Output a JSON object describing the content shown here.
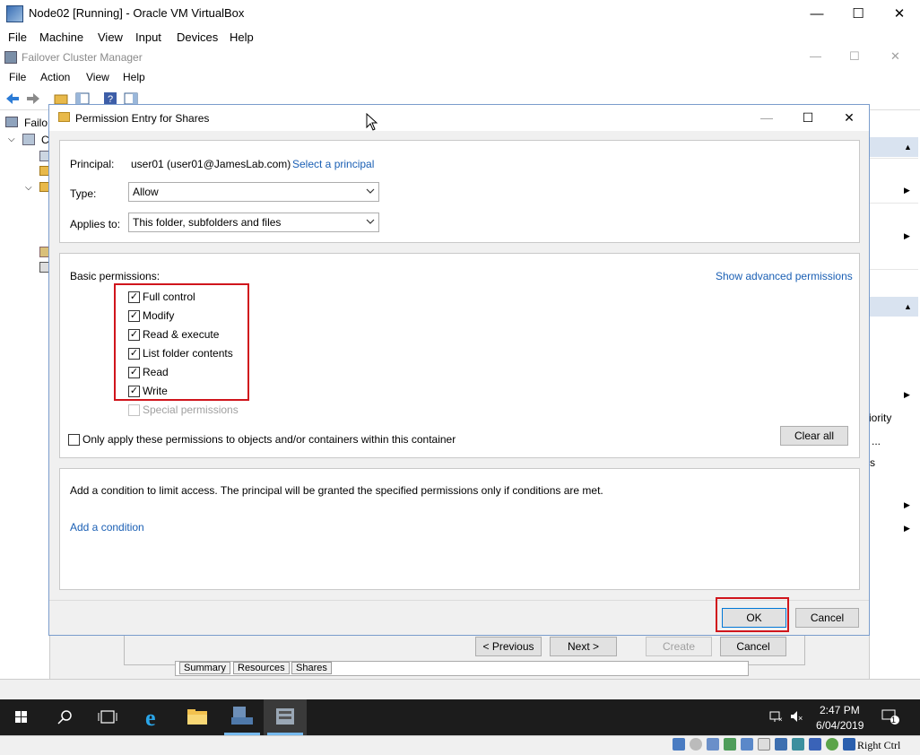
{
  "vbox": {
    "title": "Node02 [Running] - Oracle VM VirtualBox",
    "menu": [
      "File",
      "Machine",
      "View",
      "Input",
      "Devices",
      "Help"
    ],
    "minimize": "—",
    "maximize": "☐",
    "close": "✕",
    "host_key": "Right Ctrl"
  },
  "fcm": {
    "title": "Failover Cluster Manager",
    "menu": [
      "File",
      "Action",
      "View",
      "Help"
    ],
    "tree_root": "Failo",
    "tree_child": "C",
    "right_pane_snippets": [
      "iority",
      "...",
      "s"
    ]
  },
  "wizard": {
    "previous_label": "< Previous",
    "next_label": "Next >",
    "create_label": "Create",
    "cancel_label": "Cancel",
    "tabs": [
      "Summary",
      "Resources",
      "Shares"
    ]
  },
  "dialog": {
    "title": "Permission Entry for Shares",
    "principal_label": "Principal:",
    "principal_value": "user01 (user01@JamesLab.com)",
    "select_principal_link": "Select a principal",
    "type_label": "Type:",
    "type_value": "Allow",
    "applies_label": "Applies to:",
    "applies_value": "This folder, subfolders and files",
    "basic_permissions_label": "Basic permissions:",
    "show_advanced_link": "Show advanced permissions",
    "permissions": [
      {
        "label": "Full control",
        "checked": true
      },
      {
        "label": "Modify",
        "checked": true
      },
      {
        "label": "Read & execute",
        "checked": true
      },
      {
        "label": "List folder contents",
        "checked": true
      },
      {
        "label": "Read",
        "checked": true
      },
      {
        "label": "Write",
        "checked": true
      }
    ],
    "special_permissions_label": "Special permissions",
    "only_apply_label": "Only apply these permissions to objects and/or containers within this container",
    "clear_all_label": "Clear all",
    "condition_text": "Add a condition to limit access. The principal will be granted the specified permissions only if conditions are met.",
    "add_condition_link": "Add a condition",
    "ok_label": "OK",
    "cancel_label": "Cancel",
    "check_mark": "✓"
  },
  "taskbar": {
    "time": "2:47 PM",
    "date": "6/04/2019",
    "notification_count": "1"
  },
  "colors": {
    "highlight_red": "#d0151c",
    "link_blue": "#1a5fb4",
    "taskbar": "#1c1c1c"
  }
}
